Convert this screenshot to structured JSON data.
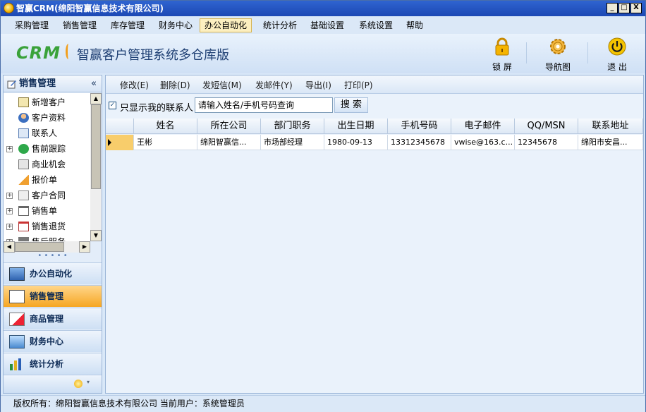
{
  "window": {
    "title": "智赢CRM(绵阳智赢信息技术有限公司)",
    "min": "_",
    "max": "□",
    "close": "X"
  },
  "menu": [
    {
      "label": "采购管理"
    },
    {
      "label": "销售管理"
    },
    {
      "label": "库存管理"
    },
    {
      "label": "财务中心"
    },
    {
      "label": "办公自动化",
      "active": true
    },
    {
      "label": "统计分析"
    },
    {
      "label": "基础设置"
    },
    {
      "label": "系统设置"
    },
    {
      "label": "帮助"
    }
  ],
  "banner": {
    "logo": "CRM",
    "title": "智赢客户管理系统多仓库版",
    "tools": [
      {
        "label": "锁 屏",
        "icon": "lock-icon"
      },
      {
        "label": "导航图",
        "icon": "gear-icon"
      },
      {
        "label": "退 出",
        "icon": "power-icon"
      }
    ]
  },
  "sidebar": {
    "title": "销售管理",
    "collapse": "«",
    "tree": [
      {
        "label": "新增客户",
        "icon": "add-customer-icon"
      },
      {
        "label": "客户资料",
        "icon": "customer-icon"
      },
      {
        "label": "联系人",
        "icon": "contact-icon"
      },
      {
        "label": "售前跟踪",
        "icon": "check-circle-icon",
        "expander": "+"
      },
      {
        "label": "商业机会",
        "icon": "pen-icon"
      },
      {
        "label": "报价单",
        "icon": "quote-icon"
      },
      {
        "label": "客户合同",
        "icon": "contract-icon",
        "expander": "+"
      },
      {
        "label": "销售单",
        "icon": "sales-order-icon",
        "expander": "+"
      },
      {
        "label": "销售退货",
        "icon": "return-icon",
        "expander": "+"
      },
      {
        "label": "售后服务",
        "icon": "service-icon",
        "expander": "+"
      }
    ],
    "nav": [
      {
        "label": "办公自动化",
        "icon": "monitor-icon"
      },
      {
        "label": "销售管理",
        "icon": "sales-icon",
        "active": true
      },
      {
        "label": "商品管理",
        "icon": "goods-icon"
      },
      {
        "label": "财务中心",
        "icon": "finance-icon"
      },
      {
        "label": "统计分析",
        "icon": "chart-icon"
      }
    ]
  },
  "actions": [
    {
      "label": "修改(E)"
    },
    {
      "label": "删除(D)"
    },
    {
      "label": "发短信(M)"
    },
    {
      "label": "发邮件(Y)"
    },
    {
      "label": "导出(I)"
    },
    {
      "label": "打印(P)"
    }
  ],
  "filter": {
    "checked": true,
    "label": "只显示我的联系人",
    "search_value": "请输入姓名/手机号码查询",
    "search_button": "搜 索"
  },
  "grid": {
    "columns": [
      "姓名",
      "所在公司",
      "部门职务",
      "出生日期",
      "手机号码",
      "电子邮件",
      "QQ/MSN",
      "联系地址"
    ],
    "rows": [
      [
        "王彬",
        "绵阳智赢信...",
        "市场部经理",
        "1980-09-13",
        "13312345678",
        "vwise@163.c...",
        "12345678",
        "绵阳市安昌..."
      ]
    ]
  },
  "status": {
    "text": "版权所有：绵阳智赢信息技术有限公司  当前用户：系统管理员"
  }
}
